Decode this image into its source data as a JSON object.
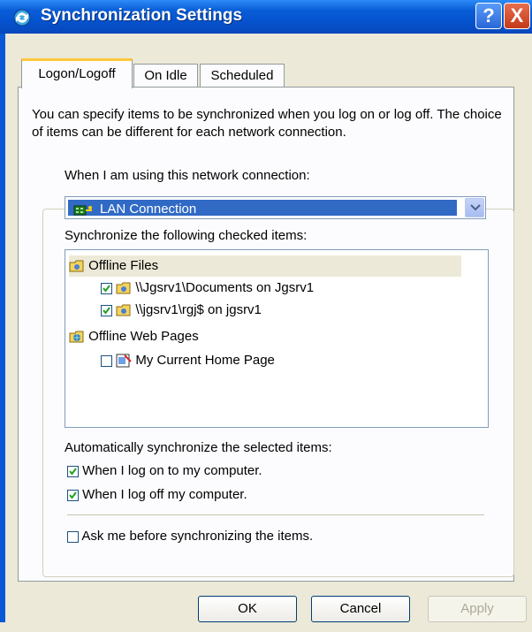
{
  "window": {
    "title": "Synchronization Settings",
    "help_glyph": "?",
    "close_glyph": "X"
  },
  "tabs": [
    {
      "label": "Logon/Logoff"
    },
    {
      "label": "On Idle"
    },
    {
      "label": "Scheduled"
    }
  ],
  "description": "You can specify items to be synchronized when you log on or log off. The choice of items can be different for each network connection.",
  "connection": {
    "label": "When I am using this network connection:",
    "selected": "LAN Connection"
  },
  "items_label": "Synchronize the following checked items:",
  "tree": {
    "offline_files": "Offline Files",
    "item1": {
      "label": "\\\\Jgsrv1\\Documents on Jgsrv1",
      "checked": true
    },
    "item2": {
      "label": "\\\\jgsrv1\\rgj$ on jgsrv1",
      "checked": true
    },
    "offline_web": "Offline Web Pages",
    "item3": {
      "label": "My Current Home Page",
      "checked": false
    }
  },
  "auto_label": "Automatically synchronize the selected items:",
  "options": {
    "logon": {
      "label": "When I log on to my computer.",
      "checked": true
    },
    "logoff": {
      "label": "When I log off my computer.",
      "checked": true
    },
    "ask": {
      "label": "Ask me before synchronizing the items.",
      "checked": false
    }
  },
  "buttons": {
    "ok": "OK",
    "cancel": "Cancel",
    "apply": "Apply"
  },
  "colors": {
    "title_bar": "#0553CF",
    "selection": "#316AC5",
    "check": "#21A121",
    "face": "#ECE9D8"
  }
}
